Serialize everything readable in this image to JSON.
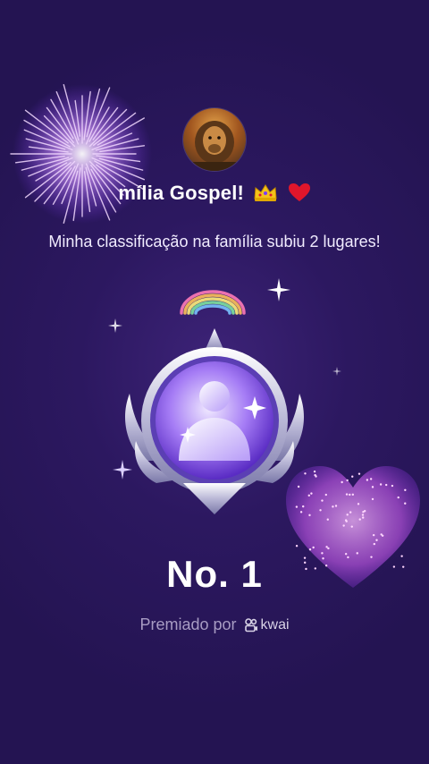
{
  "header": {
    "title": "mília Gospel!",
    "subtitle": "Minha classificação na família subiu 2 lugares!"
  },
  "rank": {
    "label": "No. 1"
  },
  "footer": {
    "awarded_by": "Premiado por",
    "brand": "kwai"
  },
  "icons": {
    "avatar": "lion-avatar",
    "title_emoji_1": "crown-icon",
    "title_emoji_2": "heart-icon",
    "badge": "person-medal-badge",
    "brand_logo": "kwai-logo-icon"
  },
  "colors": {
    "background": "#2c1860",
    "badge_purple": "#8b5cf6",
    "firework_purple": "#c77dff",
    "heart_crown_red": "#e0162b"
  }
}
